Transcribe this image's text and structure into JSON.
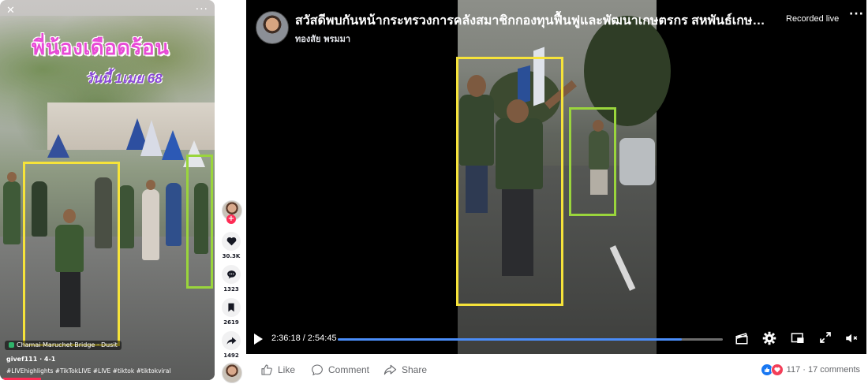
{
  "tiktok": {
    "overlay_title": "พี่น้องเดือดร้อน",
    "overlay_date": "วันนี้ 1เมย 68",
    "location_tag": "Chamai Maruchet Bridge · Dusit",
    "user_line": "givef111 · 4-1",
    "hashtags": "#LIVEhighlights #TikTokLIVE #LIVE #tiktok #tiktokviral",
    "more": "···",
    "close": "✕",
    "plus": "+",
    "counts": {
      "likes": "30.3K",
      "comments": "1323",
      "saves": "2619",
      "shares": "1492"
    }
  },
  "facebook": {
    "title": "สวัสดีพบกันหน้ากระทรวงการคลังสมาชิกกองทุนฟื้นฟูและพัฒนาเกษตรกร สหพันธ์เกษตรกร",
    "author": "ทองสัย พรมมา",
    "recorded": "Recorded live",
    "more": "···",
    "time_display": "2:36:18 / 2:54:45",
    "progress": 0.894,
    "actions": {
      "like": "Like",
      "comment": "Comment",
      "share": "Share"
    },
    "reactions_summary": "117 · 17 comments"
  },
  "colors": {
    "yellow_box": "#f6e33a",
    "green_box": "#9ad53c",
    "fb_progress": "#4a8df8",
    "tiktok_red": "#fe2c55"
  },
  "icons": [
    "close-icon",
    "more-icon",
    "heart-icon",
    "comment-bubble-icon",
    "bookmark-icon",
    "share-arrow-icon",
    "play-icon",
    "clapper-icon",
    "gear-icon",
    "pip-icon",
    "fullscreen-icon",
    "mute-icon",
    "like-thumb-icon",
    "comment-icon",
    "share-icon"
  ]
}
